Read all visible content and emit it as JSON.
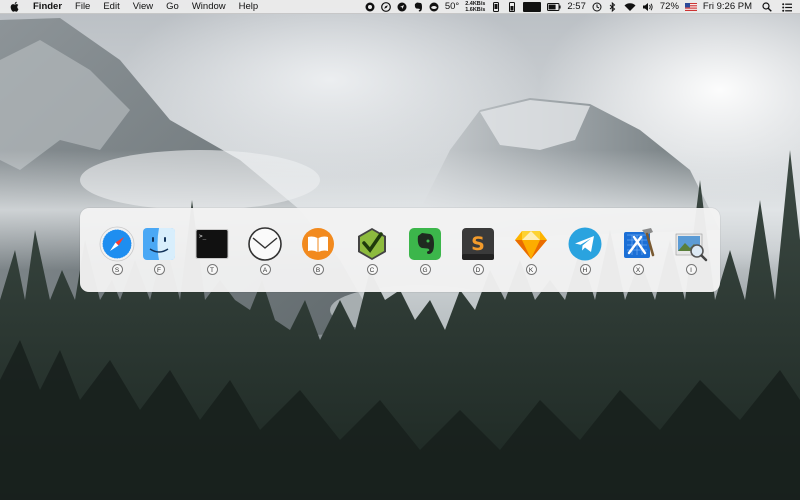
{
  "menubar": {
    "app_name": "Finder",
    "menus": [
      "File",
      "Edit",
      "View",
      "Go",
      "Window",
      "Help"
    ],
    "weather_temp": "50°",
    "net_up": "2.4KB/s",
    "net_down": "1.6KB/s",
    "battery_time": "2:57",
    "battery_percent": "72%",
    "clock": "Fri 9:26 PM",
    "tray_icons": [
      "target-icon",
      "compass-icon",
      "location-icon",
      "evernote-icon",
      "cloud-icon",
      "phone-icon",
      "thermo-icon",
      "battery-icon",
      "history-icon",
      "bluetooth-icon",
      "wifi-icon",
      "volume-icon",
      "us-flag-icon",
      "search-icon",
      "list-icon"
    ]
  },
  "switcher": {
    "apps": [
      {
        "icon": "safari-icon",
        "key": "S"
      },
      {
        "icon": "finder-icon",
        "key": "F"
      },
      {
        "icon": "terminal-icon",
        "key": "T"
      },
      {
        "icon": "airmail-icon",
        "key": "A"
      },
      {
        "icon": "ibooks-icon",
        "key": "B"
      },
      {
        "icon": "cuda-icon",
        "key": "C"
      },
      {
        "icon": "evernote-icon",
        "key": "G"
      },
      {
        "icon": "sublime-text-icon",
        "key": "D"
      },
      {
        "icon": "sketch-icon",
        "key": "K"
      },
      {
        "icon": "telegram-icon",
        "key": "H"
      },
      {
        "icon": "xcode-icon",
        "key": "X"
      },
      {
        "icon": "preview-icon",
        "key": "I"
      }
    ],
    "terminal_prompt": ">_"
  },
  "colors": {
    "panel": "#f3f3f3",
    "menubar": "#ececec",
    "safari_blue": "#1e8ef0",
    "books_orange": "#f28a1e",
    "evernote_green": "#3cb64b",
    "telegram_blue": "#2aa3df"
  }
}
